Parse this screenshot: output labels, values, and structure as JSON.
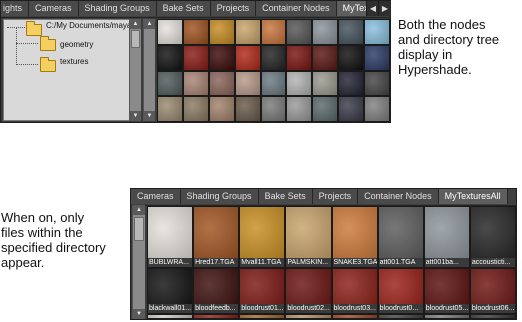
{
  "top_panel": {
    "tabs": [
      {
        "label": "ights"
      },
      {
        "label": "Cameras"
      },
      {
        "label": "Shading Groups"
      },
      {
        "label": "Bake Sets"
      },
      {
        "label": "Projects"
      },
      {
        "label": "Container Nodes"
      },
      {
        "label": "MyTexturesAll",
        "active": true
      }
    ],
    "tree": {
      "root_label": "C:/My Documents/maya",
      "children": [
        {
          "label": "geometry"
        },
        {
          "label": "textures"
        }
      ]
    },
    "swatch_rows": [
      [
        "#e7e3dd",
        "#a0521f",
        "#c78c22",
        "#c9a56c",
        "#c8753c",
        "#555555",
        "#8c949a",
        "#44525c",
        "#8ac0e0"
      ],
      [
        "#111111",
        "#8a1a14",
        "#3a0a08",
        "#b02818",
        "#222222",
        "#7a1410",
        "#5a1612",
        "#0e0e0e",
        "#2b3a66"
      ],
      [
        "#505a5c",
        "#a88474",
        "#8a645a",
        "#b89a8a",
        "#6a7a82",
        "#b4b4b4",
        "#9a9a90",
        "#222233",
        "#444444"
      ],
      [
        "#9a8a70",
        "#8a7a62",
        "#a2826a",
        "#6a5a4a",
        "#7a7a7a",
        "#9a9a9a",
        "#5a6a6a",
        "#3a3a4a",
        "#808080"
      ]
    ]
  },
  "bottom_panel": {
    "tabs": [
      {
        "label": "Cameras"
      },
      {
        "label": "Shading Groups"
      },
      {
        "label": "Bake Sets"
      },
      {
        "label": "Projects"
      },
      {
        "label": "Container Nodes"
      },
      {
        "label": "MyTexturesAll",
        "active": true
      }
    ],
    "swatches": [
      {
        "label": "BUBLWRA...",
        "color": "#e4e0da"
      },
      {
        "label": "Hred17.TGA",
        "color": "#a0521f"
      },
      {
        "label": "Mvall11.TGA",
        "color": "#c98e20"
      },
      {
        "label": "PALMSKIN...",
        "color": "#c7a36a"
      },
      {
        "label": "SNAKE3.TGA",
        "color": "#cc7838"
      },
      {
        "label": "att001.TGA",
        "color": "#5a5a5a"
      },
      {
        "label": "att001ba...",
        "color": "#8c949a"
      },
      {
        "label": "accousticti...",
        "color": "#222222"
      },
      {
        "label": "blackwall01...",
        "color": "#101010"
      },
      {
        "label": "bloodfeedb...",
        "color": "#3a0c0a"
      },
      {
        "label": "bloodrust01...",
        "color": "#7c1612"
      },
      {
        "label": "bloodrust02...",
        "color": "#6a120e"
      },
      {
        "label": "bloodrust03...",
        "color": "#8a1c14"
      },
      {
        "label": "bloodrust0...",
        "color": "#9a1e16"
      },
      {
        "label": "bloodrust05...",
        "color": "#5a0e0c"
      },
      {
        "label": "bloodrust06...",
        "color": "#6e1410"
      }
    ],
    "bottom_row_colors": [
      "#cfc9c2",
      "#8a2418",
      "#a06a30",
      "#b0926c",
      "#9a4a2a",
      "#444444",
      "#7a7a7a",
      "#3a3a3a"
    ]
  },
  "captions": {
    "top": [
      "Both the nodes",
      "and directory tree",
      "display in",
      "Hypershade."
    ],
    "bottom": [
      "When on, only",
      "files within the",
      "specified directory",
      "appear."
    ]
  }
}
